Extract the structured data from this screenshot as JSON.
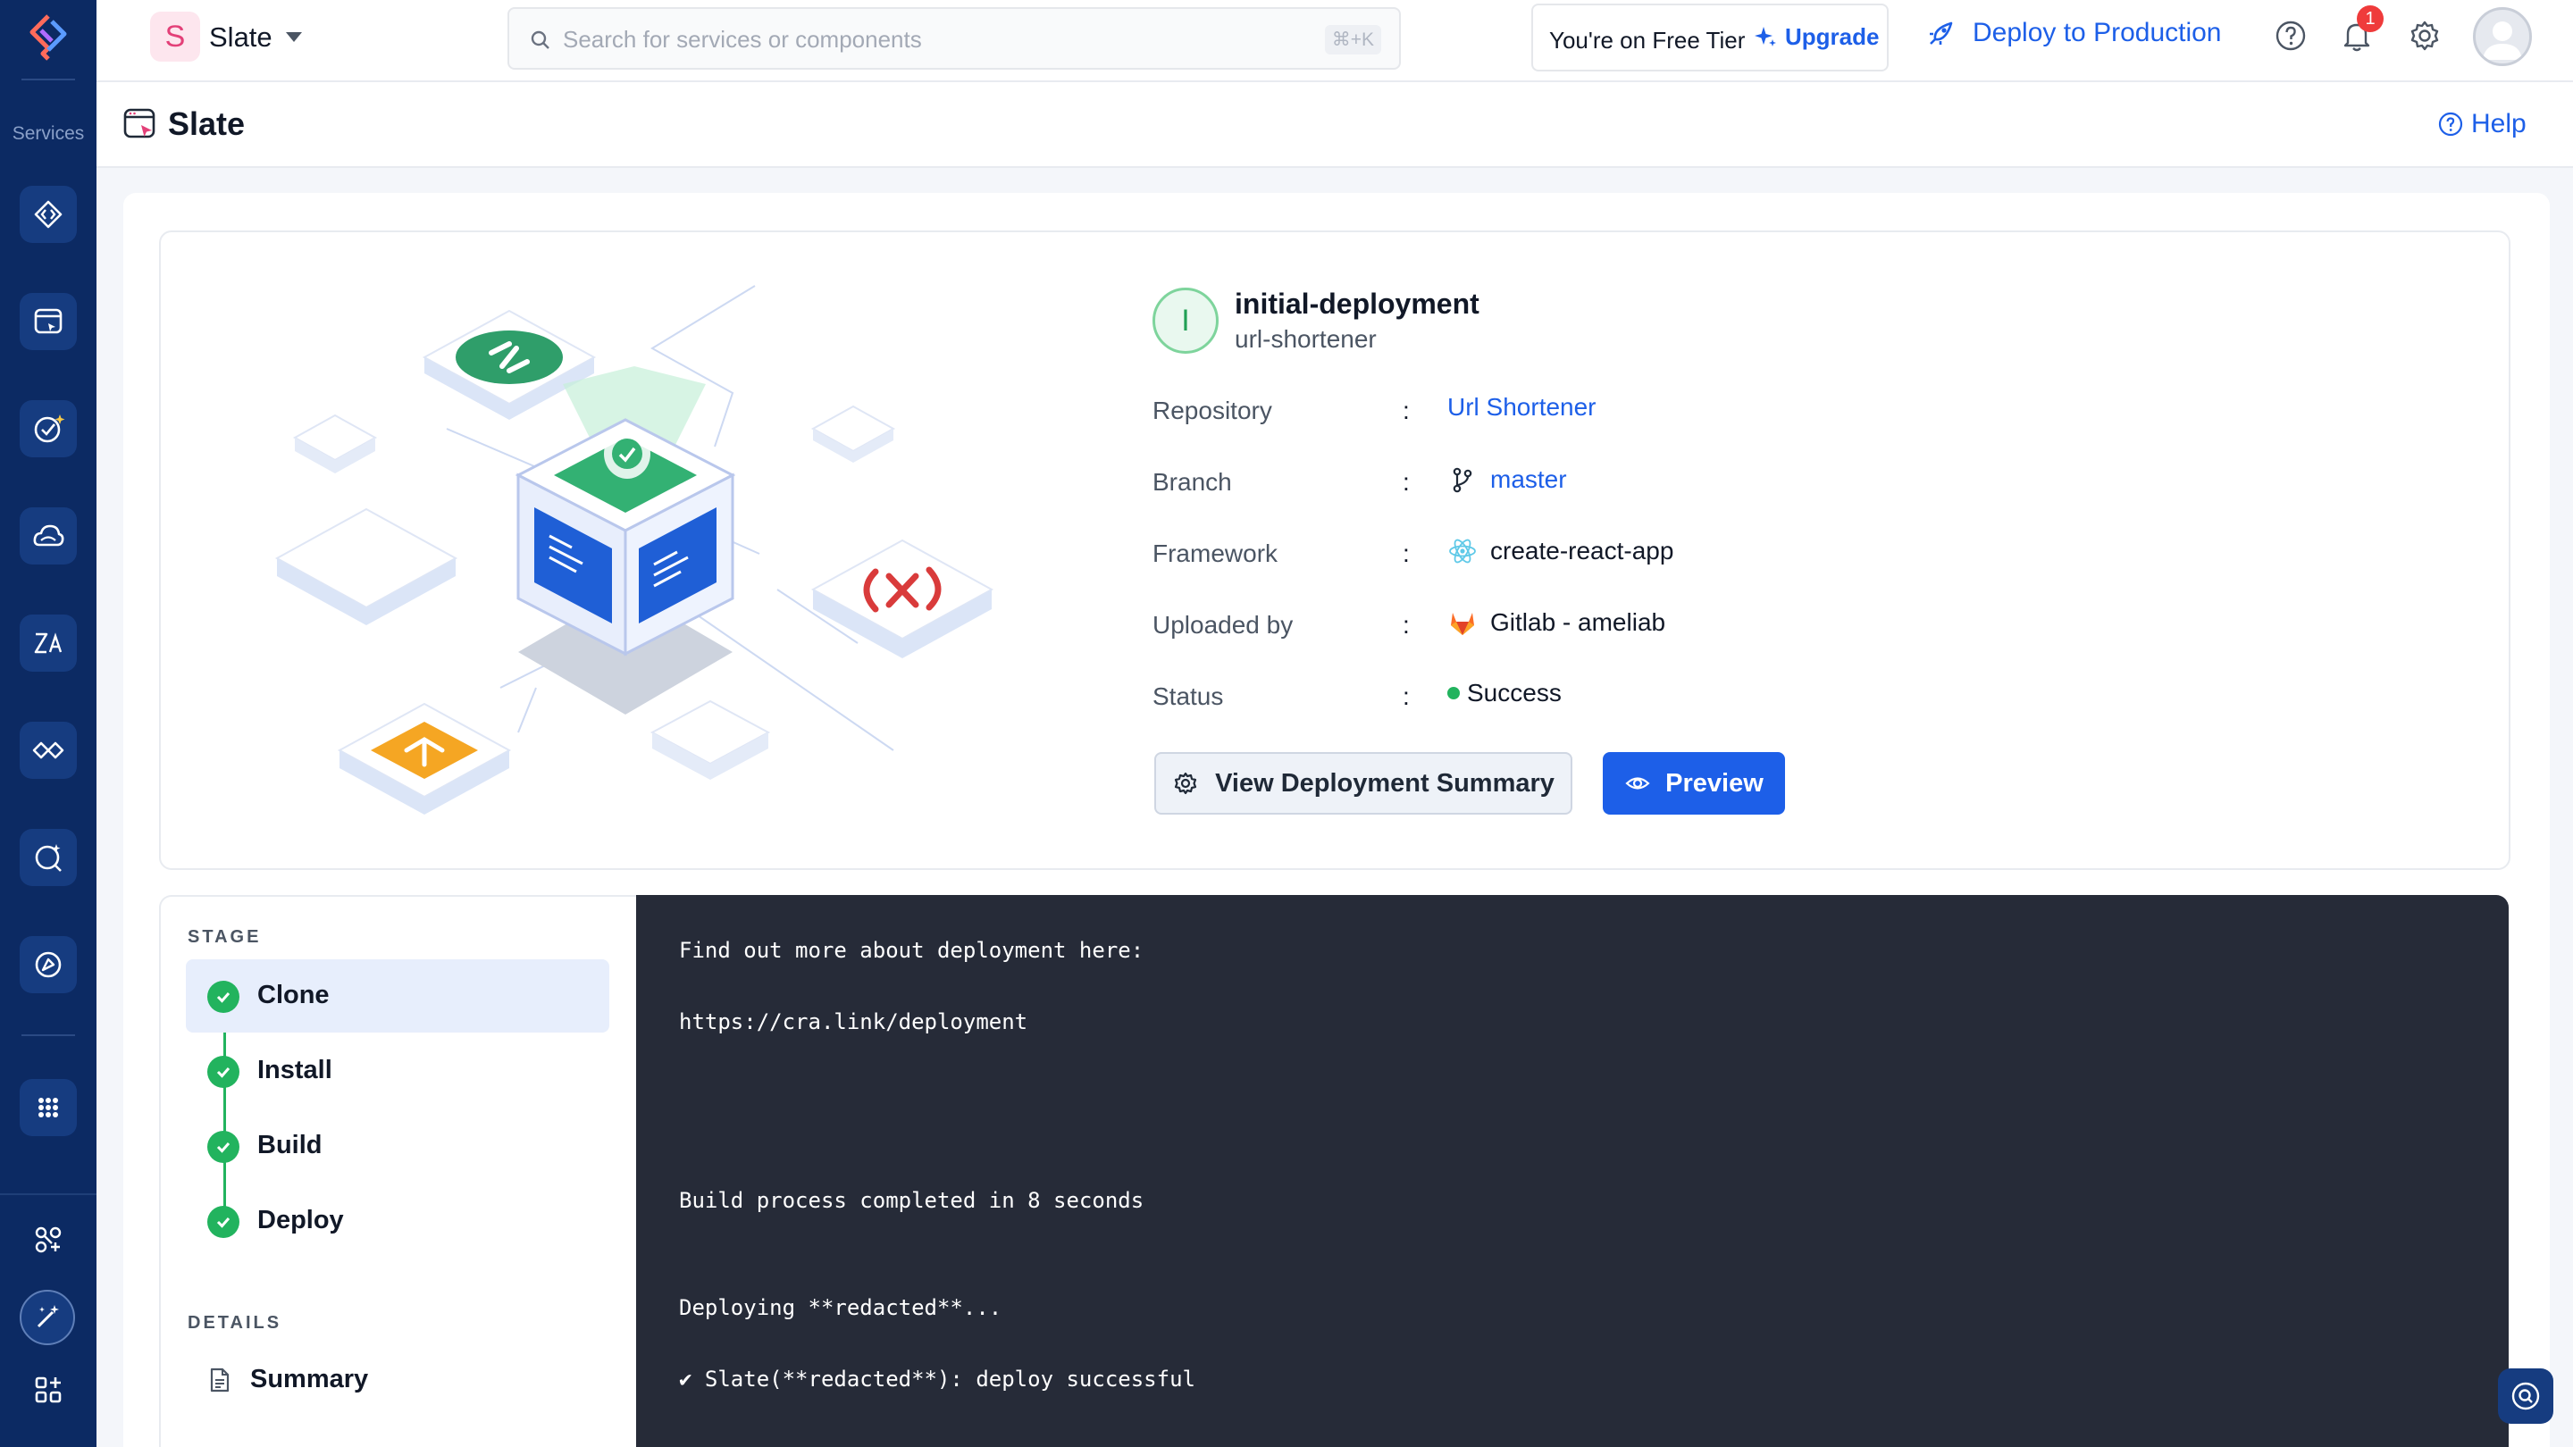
{
  "rail": {
    "caption": "Services",
    "items": [
      {
        "icon": "code-bracket-icon",
        "label": "API"
      },
      {
        "icon": "slate-window-icon",
        "label": "Slate"
      },
      {
        "icon": "testing-check-icon",
        "label": "Testing"
      },
      {
        "icon": "cloud-icon",
        "label": "Cloud"
      },
      {
        "icon": "translate-icon",
        "label": "Localization"
      },
      {
        "icon": "connectors-icon",
        "label": "Connectors"
      },
      {
        "icon": "insights-icon",
        "label": "Insights"
      },
      {
        "icon": "launch-icon",
        "label": "Launch"
      },
      {
        "icon": "apps-grid-icon",
        "label": "All services"
      }
    ],
    "bottom": [
      "integrations-icon",
      "magic-wand-icon",
      "add-widget-icon"
    ]
  },
  "topbar": {
    "project_initial": "S",
    "project_name": "Slate",
    "search_placeholder": "Search for services or components",
    "search_shortcut": "⌘+K",
    "tier_text": "You're on Free Tier",
    "upgrade_label": "Upgrade",
    "deploy_label": "Deploy to Production",
    "notification_count": "1"
  },
  "page": {
    "title": "Slate",
    "help_label": "Help"
  },
  "deployment": {
    "initial": "I",
    "name": "initial-deployment",
    "project": "url-shortener",
    "fields": {
      "repository": {
        "label": "Repository",
        "value": "Url Shortener"
      },
      "branch": {
        "label": "Branch",
        "value": "master"
      },
      "framework": {
        "label": "Framework",
        "value": "create-react-app"
      },
      "uploaded_by": {
        "label": "Uploaded by",
        "value": "Gitlab - ameliab"
      },
      "status": {
        "label": "Status",
        "value": "Success"
      }
    },
    "colon": ":",
    "summary_button": "View Deployment Summary",
    "preview_button": "Preview"
  },
  "stages": {
    "section_label": "STAGE",
    "items": [
      {
        "label": "Clone",
        "state": "done",
        "active": true
      },
      {
        "label": "Install",
        "state": "done",
        "active": false
      },
      {
        "label": "Build",
        "state": "done",
        "active": false
      },
      {
        "label": "Deploy",
        "state": "done",
        "active": false
      }
    ],
    "details_label": "DETAILS",
    "summary_label": "Summary"
  },
  "terminal": {
    "lines": [
      "Find out more about deployment here:",
      "https://cra.link/deployment",
      "Build process completed in 8 seconds",
      "Deploying **redacted**...",
      "✔ Slate(**redacted**): deploy successful"
    ]
  },
  "colors": {
    "rail_bg": "#0c2a63",
    "accent": "#1d5fe8",
    "success": "#22b35e",
    "terminal_bg": "#262b38"
  }
}
